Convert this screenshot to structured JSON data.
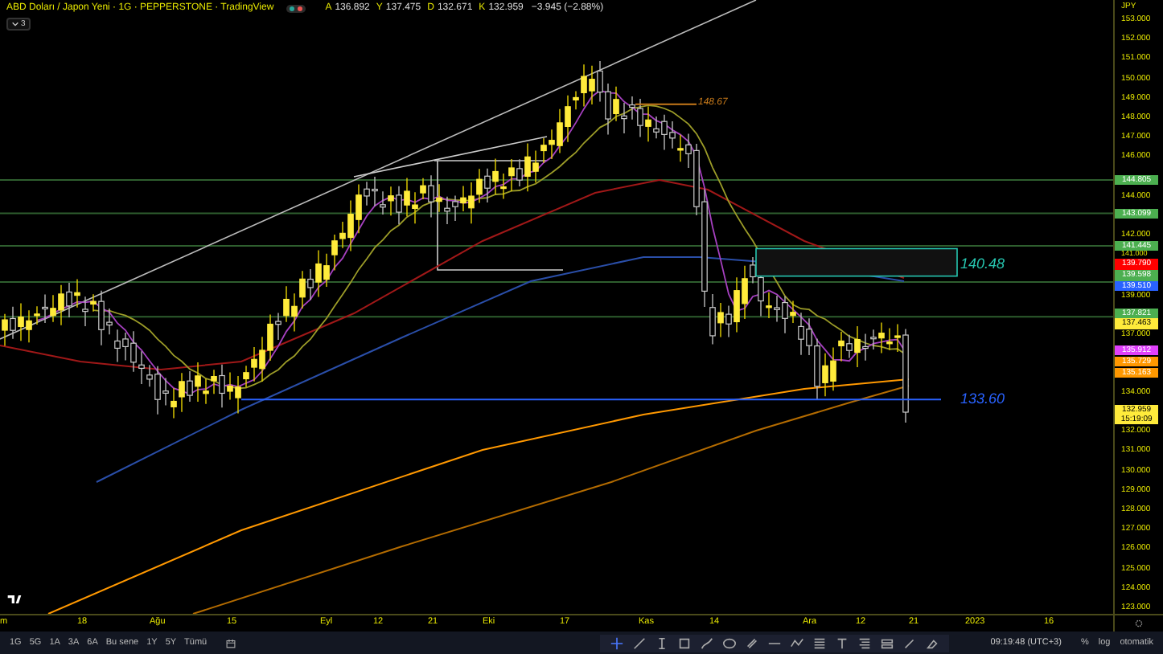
{
  "header": {
    "title": "ABD Doları / Japon Yeni · 1G · PEPPERSTONE · TradingView",
    "status_dots": [
      {
        "color": "#26a69a"
      },
      {
        "color": "#ef5350"
      }
    ],
    "ohlc": [
      {
        "label": "A",
        "value": "136.892"
      },
      {
        "label": "Y",
        "value": "137.475"
      },
      {
        "label": "D",
        "value": "132.671"
      },
      {
        "label": "K",
        "value": "132.959"
      }
    ],
    "change": "−3.945 (−2.88%)",
    "indicators_count": "3"
  },
  "chart": {
    "annotations": [
      {
        "text": "148.67",
        "color": "#c87a1a"
      },
      {
        "text": "140.48",
        "color": "#26c6b0"
      },
      {
        "text": "133.60",
        "color": "#2962ff"
      }
    ]
  },
  "price_axis": {
    "currency": "JPY",
    "ticks": [
      "153.000",
      "152.000",
      "151.000",
      "150.000",
      "149.000",
      "148.000",
      "147.000",
      "146.000",
      "144.000",
      "142.000",
      "141.000",
      "139.000",
      "137.000",
      "134.000",
      "132.000",
      "131.000",
      "130.000",
      "129.000",
      "128.000",
      "127.000",
      "126.000",
      "125.000",
      "124.000",
      "123.000"
    ],
    "badges": [
      {
        "text": "144.805",
        "color": "#4caf50"
      },
      {
        "text": "143.099",
        "color": "#4caf50"
      },
      {
        "text": "141.445",
        "color": "#4caf50"
      },
      {
        "text": "139.790",
        "color": "#ff0000"
      },
      {
        "text": "139.598",
        "color": "#4caf50"
      },
      {
        "text": "139.510",
        "color": "#2962ff"
      },
      {
        "text": "137.821",
        "color": "#4caf50"
      },
      {
        "text": "137.463",
        "color": "#ffeb3b"
      },
      {
        "text": "135.912",
        "color": "#e040fb"
      },
      {
        "text": "135.729",
        "color": "#ff9800"
      },
      {
        "text": "135.163",
        "color": "#ff9800"
      },
      {
        "text": "132.959",
        "color": "#ffeb3b",
        "countdown": "15:19:09"
      }
    ]
  },
  "time_axis": [
    "m",
    "18",
    "Ağu",
    "15",
    "Eyl",
    "12",
    "21",
    "Eki",
    "17",
    "Kas",
    "14",
    "Ara",
    "12",
    "21",
    "2023",
    "16"
  ],
  "bottom_bar": {
    "ranges": [
      "1G",
      "5G",
      "1A",
      "3A",
      "6A",
      "Bu sene",
      "1Y",
      "5Y",
      "Tümü"
    ],
    "clock": "09:19:48 (UTC+3)",
    "options": [
      "%",
      "log",
      "otomatik"
    ]
  }
}
